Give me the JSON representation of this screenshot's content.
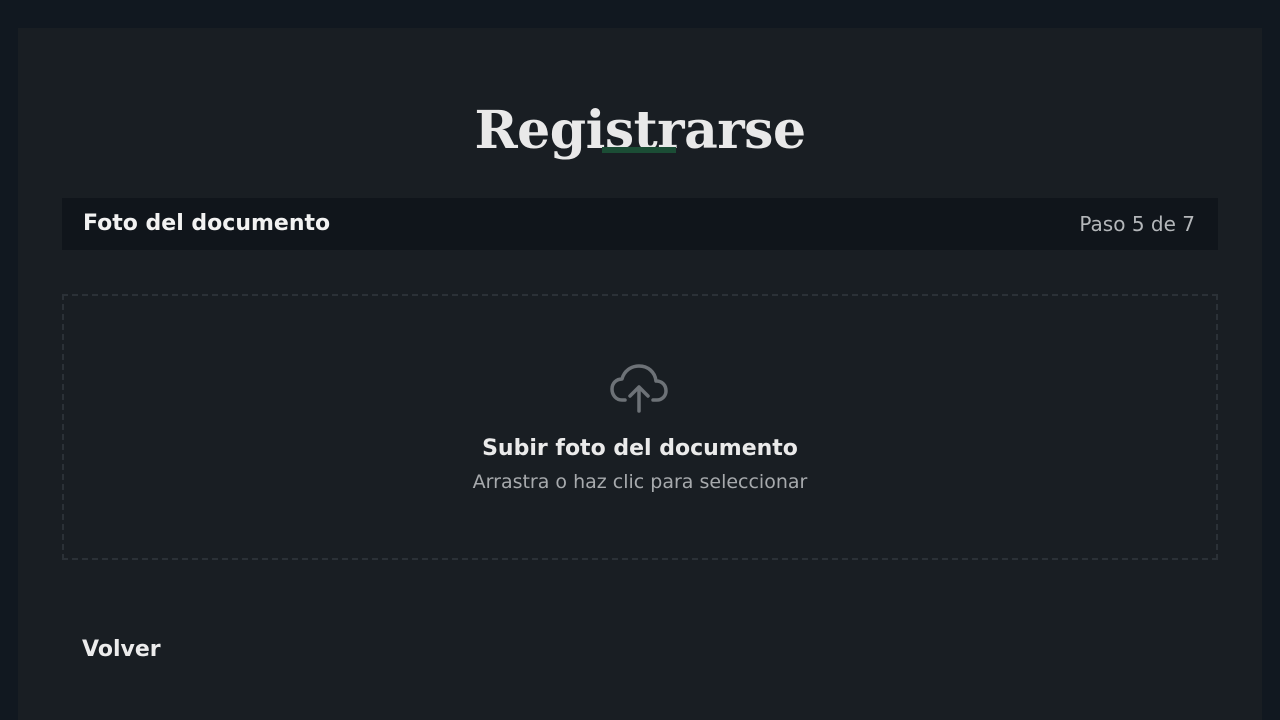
{
  "header": {
    "title": "Registrarse",
    "accent_color": "#1b4d35"
  },
  "step": {
    "title": "Foto del documento",
    "progress": "Paso 5 de 7",
    "current": 5,
    "total": 7
  },
  "upload": {
    "icon": "cloud-upload-icon",
    "title": "Subir foto del documento",
    "subtitle": "Arrastra o haz clic para seleccionar"
  },
  "actions": {
    "back_label": "Volver"
  },
  "colors": {
    "page_background": "#111820",
    "card_background": "#191e23",
    "step_bar_background": "#10151b"
  }
}
